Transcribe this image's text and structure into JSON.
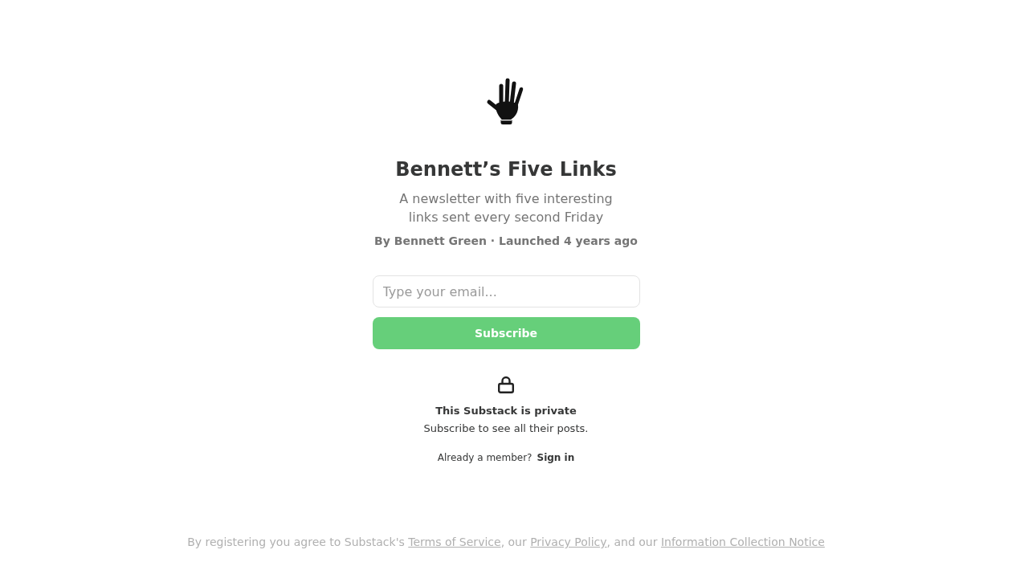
{
  "publication": {
    "title": "Bennett’s Five Links",
    "description_lines": [
      "A newsletter with five interesting",
      "links sent every second Friday"
    ],
    "byline": "By Bennett Green · Launched 4 years ago"
  },
  "signup": {
    "email": {
      "placeholder": "Type your email..."
    },
    "button": "Subscribe"
  },
  "private_notice": {
    "heading": "This Substack is private",
    "text": "Subscribe to see all their posts."
  },
  "sign_in": {
    "prompt": "Already a member?",
    "link": "Sign in"
  },
  "footer": {
    "segments": [
      {
        "kind": "text",
        "text": "By registering you agree to Substack's "
      },
      {
        "kind": "link",
        "text": "Terms of Service"
      },
      {
        "kind": "text",
        "text": ", our "
      },
      {
        "kind": "link",
        "text": "Privacy Policy"
      },
      {
        "kind": "text",
        "text": ", and our "
      },
      {
        "kind": "link",
        "text": "Information Collection Notice"
      }
    ]
  }
}
